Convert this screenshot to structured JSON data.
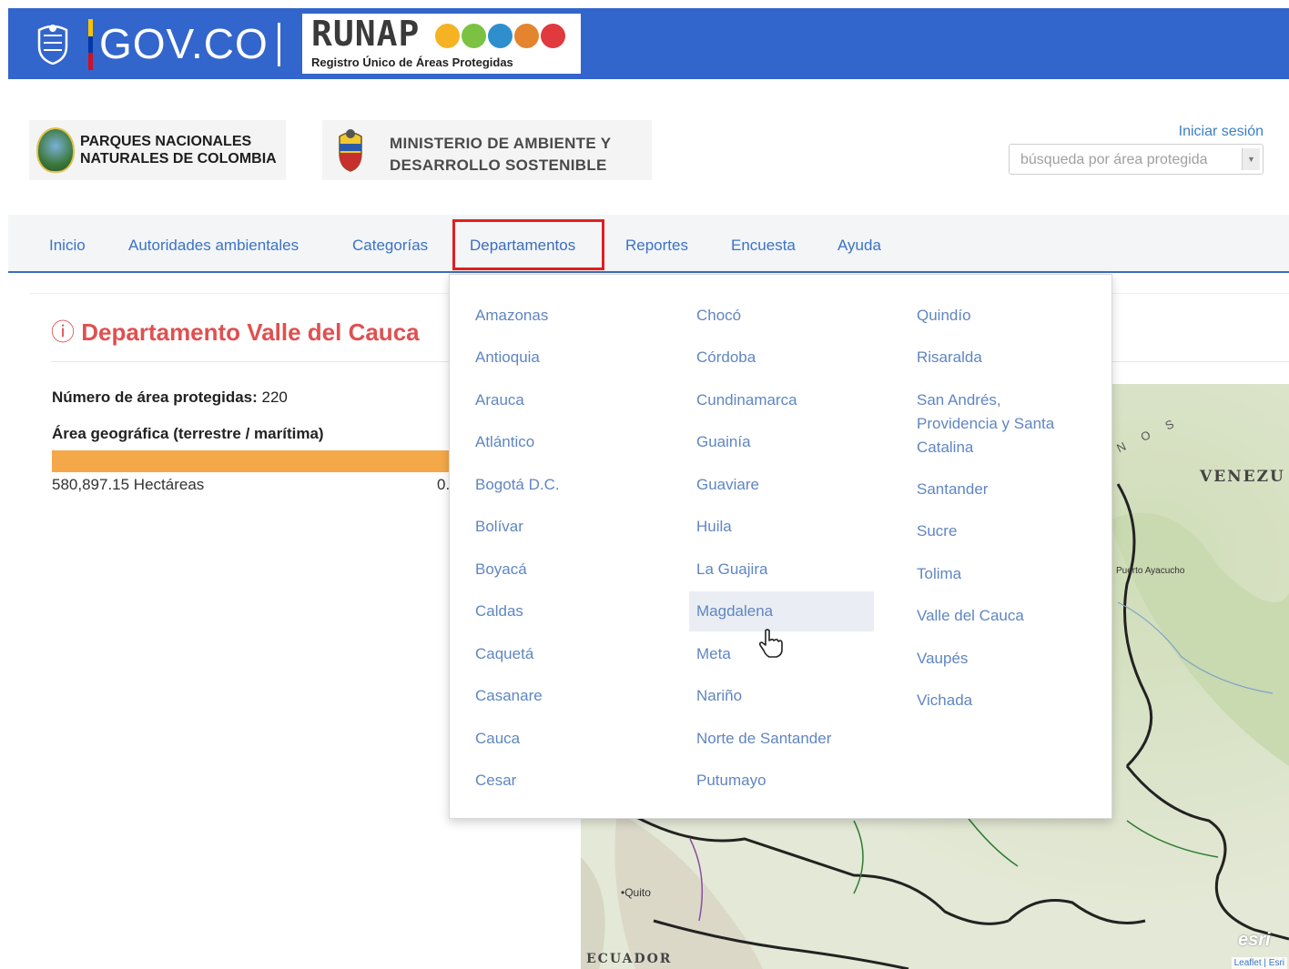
{
  "gov_bar": {
    "brand": "GOV.CO",
    "runap_title": "RUNAP",
    "runap_subtitle": "Registro Único de Áreas Protegidas",
    "colors": {
      "background": "#3366cc",
      "flag_yellow": "#f9c300",
      "flag_blue": "#0037a3",
      "flag_red": "#ce1126"
    }
  },
  "header": {
    "pnn_logo": {
      "line1": "PARQUES NACIONALES",
      "line2": "NATURALES DE COLOMBIA"
    },
    "ministry_logo": {
      "line1": "MINISTERIO DE AMBIENTE Y",
      "line2": "DESARROLLO SOSTENIBLE"
    },
    "login_link": "Iniciar sesión",
    "search_select": {
      "placeholder": "búsqueda por área protegida"
    }
  },
  "nav": {
    "items": [
      {
        "label": "Inicio"
      },
      {
        "label": "Autoridades ambientales"
      },
      {
        "label": "Categorías"
      },
      {
        "label": "Departamentos",
        "active": true
      },
      {
        "label": "Reportes"
      },
      {
        "label": "Encuesta"
      },
      {
        "label": "Ayuda"
      }
    ]
  },
  "department": {
    "title": "Departamento Valle del Cauca",
    "protected_count_label": "Número de área protegidas:",
    "protected_count_value": "220",
    "geo_area_label": "Área geográfica (terrestre / marítima)",
    "geo_area_value": "580,897.15 Hectáreas",
    "geo_area_right_fragment": "0.",
    "terrestrial_fraction": 1.0,
    "bar_color": "#f4a84a"
  },
  "departments_menu": {
    "columns": [
      [
        "Amazonas",
        "Antioquia",
        "Arauca",
        "Atlántico",
        "Bogotá D.C.",
        "Bolívar",
        "Boyacá",
        "Caldas",
        "Caquetá",
        "Casanare",
        "Cauca",
        "Cesar"
      ],
      [
        "Chocó",
        "Córdoba",
        "Cundinamarca",
        "Guainía",
        "Guaviare",
        "Huila",
        "La Guajira",
        "Magdalena",
        "Meta",
        "Nariño",
        "Norte de Santander",
        "Putumayo"
      ],
      [
        "Quindío",
        "Risaralda",
        "San Andrés, Providencia y Santa Catalina",
        "Santander",
        "Sucre",
        "Tolima",
        "Valle del Cauca",
        "Vaupés",
        "Vichada"
      ]
    ],
    "hovered": "Magdalena",
    "link_color": "#5f86c2"
  },
  "map": {
    "labels": {
      "venezuela": "VENEZU",
      "ecuador": "ECUADOR",
      "quito": "Quito",
      "puerto_ayacucho": "Puerto Ayacucho",
      "andes_fragment": "N O S",
      "attribution": "Leaflet | Esri",
      "esri": "esri"
    }
  }
}
